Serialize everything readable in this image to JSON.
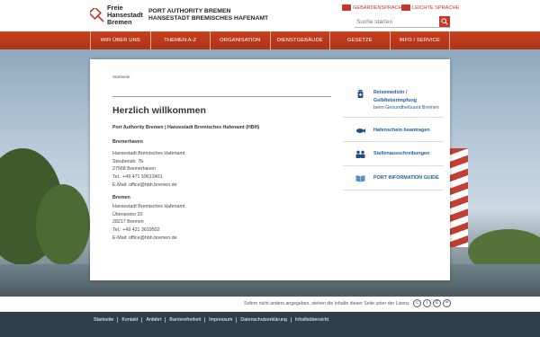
{
  "header": {
    "logo_lines": [
      "Freie",
      "Hansestadt",
      "Bremen"
    ],
    "org_line1": "PORT AUTHORITY BREMEN",
    "org_line2": "HANSESTADT BREMISCHES HAFENAMT",
    "lang_sign": "GEBÄRDENSPRACHE",
    "lang_easy": "LEICHTE SPRACHE",
    "search_placeholder": "Suche starten",
    "brand_color": "#c0392b"
  },
  "nav": {
    "items": [
      "WIR ÜBER UNS",
      "THEMEN A-Z",
      "ORGANISATION",
      "DIENSTGEBÄUDE",
      "GESETZE",
      "INFO / SERVICE"
    ]
  },
  "main": {
    "breadcrumb": "Startseite",
    "title": "Herzlich willkommen",
    "intro": "Port Authority Bremen | Hansestadt Bremisches Hafenamt (HBH)",
    "bremerhaven": {
      "heading": "Bremerhaven",
      "lines": [
        "Hansestadt Bremisches Hafenamt",
        "Steubenstr. 7b",
        "27568 Bremerhaven",
        "Tel.: +49 471 59613401",
        "E-Mail: office@hbh.bremen.de"
      ]
    },
    "bremen": {
      "heading": "Bremen",
      "lines": [
        "Hansestadt Bremisches Hafenamt",
        "Überseetor 20",
        "28217 Bremen",
        "Tel.: +49 421 3619502",
        "E-Mail: office@hbh.bremen.de"
      ]
    }
  },
  "sidebar": {
    "items": [
      {
        "label_line1": "Reisemedizin /",
        "label_line2": "Gelbfieberimpfung",
        "sub": "beim Gesundheitsamt Bremen",
        "icon": "medicine-bottle-icon"
      },
      {
        "label": "Hafenschein beantragen",
        "icon": "fish-icon"
      },
      {
        "label": "Stellenausschreibungen",
        "icon": "people-icon"
      },
      {
        "label": "PORT INFORMATION GUIDE",
        "icon": "book-icon"
      }
    ]
  },
  "license": {
    "text": "Sofern nicht anders angegeben, stehen die Inhalte dieser Seite unter der Lizenz",
    "icons": [
      "cc-icon",
      "by-icon",
      "nc-icon",
      "sa-icon"
    ]
  },
  "footer": {
    "links": [
      "Startseite",
      "Kontakt",
      "Anfahrt",
      "Barrierefreiheit",
      "Impressum",
      "Datenschutzerklärung",
      "Inhaltsübersicht"
    ]
  }
}
